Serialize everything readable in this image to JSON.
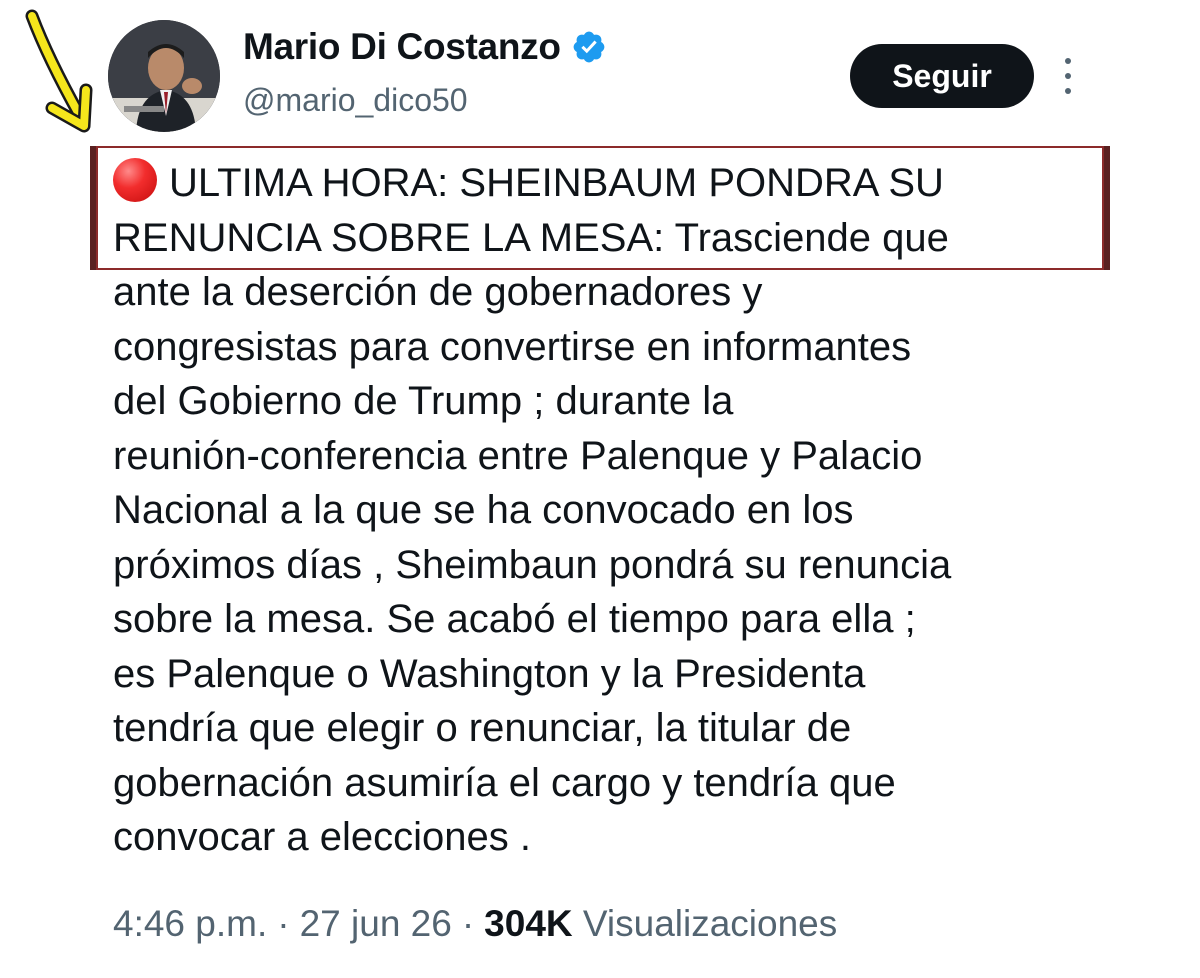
{
  "header": {
    "display_name": "Mario Di Costanzo",
    "handle": "@mario_dico50",
    "follow_label": "Seguir"
  },
  "tweet": {
    "lines": [
      "ULTIMA HORA: SHEINBAUM PONDRA SU",
      "RENUNCIA SOBRE LA MESA: Trasciende que",
      "ante la deserción de gobernadores y",
      "congresistas para convertirse en informantes",
      "del Gobierno de Trump ; durante la",
      "reunión-conferencia entre Palenque y Palacio",
      "Nacional a la que se ha convocado en los",
      "próximos días , Sheimbaun pondrá su renuncia",
      "sobre la mesa. Se acabó el tiempo para ella ;",
      "es Palenque o Washington y la Presidenta",
      "tendría que elegir o renunciar, la titular de",
      "gobernación asumiría el cargo y tendría que",
      "convocar a elecciones ."
    ]
  },
  "meta": {
    "time": "4:46 p.m.",
    "sep1": "·",
    "date": "27 jun 26",
    "sep2": "·",
    "views_count": "304K",
    "views_label": "Visualizaciones"
  },
  "icons": {
    "verified": "verified-badge-icon",
    "more": "more-vertical-icon",
    "alert": "red-circle-icon",
    "arrow": "yellow-arrow-icon"
  },
  "colors": {
    "verified": "#1d9bf0",
    "text": "#0f1419",
    "muted": "#536471",
    "highlight_border": "#8c2a2a",
    "arrow": "#f5e61c"
  }
}
